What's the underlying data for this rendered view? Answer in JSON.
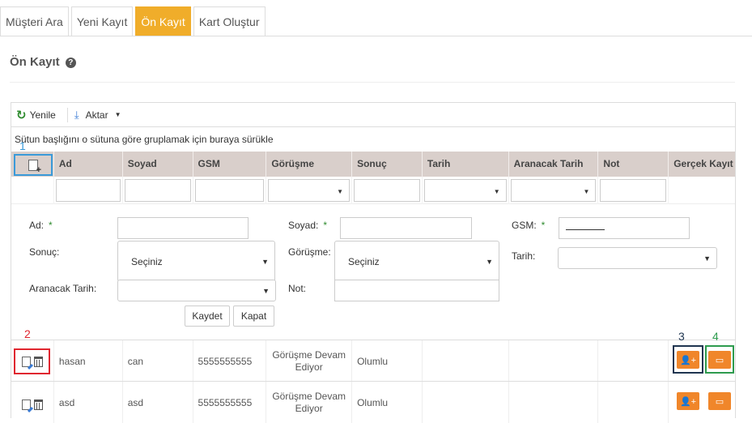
{
  "tabs": [
    {
      "label": "Müşteri Ara",
      "active": false
    },
    {
      "label": "Yeni Kayıt",
      "active": false
    },
    {
      "label": "Ön Kayıt",
      "active": true
    },
    {
      "label": "Kart Oluştur",
      "active": false
    }
  ],
  "page_title": "Ön Kayıt",
  "toolbar": {
    "refresh_label": "Yenile",
    "export_label": "Aktar"
  },
  "group_hint": "Sütun başlığını o sütuna göre gruplamak için buraya sürükle",
  "columns": [
    "Ad",
    "Soyad",
    "GSM",
    "Görüşme",
    "Sonuç",
    "Tarih",
    "Aranacak Tarih",
    "Not",
    "Gerçek Kayıt"
  ],
  "form": {
    "ad_label": "Ad:",
    "soyad_label": "Soyad:",
    "gsm_label": "GSM:",
    "required_mark": "*",
    "sonuc_label": "Sonuç:",
    "sonuc_value": "Seçiniz",
    "gorusme_label": "Görüşme:",
    "gorusme_value": "Seçiniz",
    "tarih_label": "Tarih:",
    "aranacak_label": "Aranacak Tarih:",
    "not_label": "Not:",
    "save_label": "Kaydet",
    "close_label": "Kapat"
  },
  "rows": [
    {
      "ad": "hasan",
      "soyad": "can",
      "gsm": "5555555555",
      "gorusme": "Görüşme Devam Ediyor",
      "sonuc": "Olumlu",
      "tarih": "",
      "aranacak": "",
      "not": ""
    },
    {
      "ad": "asd",
      "soyad": "asd",
      "gsm": "5555555555",
      "gorusme": "Görüşme Devam Ediyor",
      "sonuc": "Olumlu",
      "tarih": "",
      "aranacak": "",
      "not": ""
    }
  ],
  "annotations": [
    "1",
    "2",
    "3",
    "4"
  ],
  "colors": {
    "accent": "#f0ad2a",
    "action_button": "#f0862a",
    "header_bg": "#d9cfcb",
    "mark1": "#3a9ad9",
    "mark2": "#e0262f",
    "mark3": "#1f3550",
    "mark4": "#2e9b4e"
  }
}
